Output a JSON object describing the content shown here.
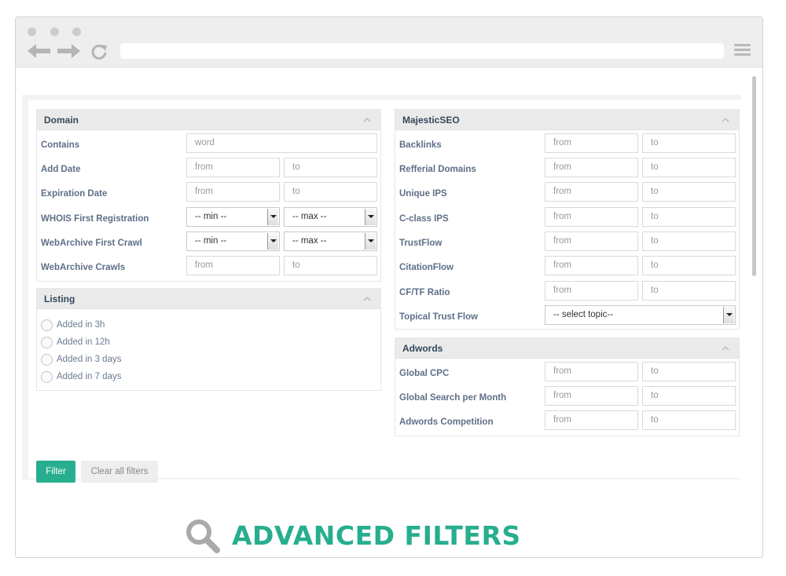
{
  "browser": {
    "colors": {
      "accent": "#27ae8f",
      "header": "#34495e",
      "label": "#5e6f87"
    }
  },
  "domain_panel": {
    "title": "Domain",
    "rows": [
      {
        "label": "Contains",
        "placeholder": "word"
      },
      {
        "label": "Add Date",
        "from": "from",
        "to": "to"
      },
      {
        "label": "Expiration Date",
        "from": "from",
        "to": "to"
      },
      {
        "label": "WHOIS First Registration",
        "min": "-- min --",
        "max": "-- max --"
      },
      {
        "label": "WebArchive First Crawl",
        "min": "-- min --",
        "max": "-- max --"
      },
      {
        "label": "WebArchive Crawls",
        "from": "from",
        "to": "to"
      }
    ]
  },
  "listing_panel": {
    "title": "Listing",
    "options": [
      "Added in 3h",
      "Added in 12h",
      "Added in 3 days",
      "Added in 7 days"
    ]
  },
  "majestic_panel": {
    "title": "MajesticSEO",
    "rows": [
      {
        "label": "Backlinks",
        "from": "from",
        "to": "to"
      },
      {
        "label": "Refferial Domains",
        "from": "from",
        "to": "to"
      },
      {
        "label": "Unique IPS",
        "from": "from",
        "to": "to"
      },
      {
        "label": "C-class IPS",
        "from": "from",
        "to": "to"
      },
      {
        "label": "TrustFlow",
        "from": "from",
        "to": "to"
      },
      {
        "label": "CitationFlow",
        "from": "from",
        "to": "to"
      },
      {
        "label": "CF/TF Ratio",
        "from": "from",
        "to": "to"
      },
      {
        "label": "Topical Trust Flow",
        "select": "-- select topic--"
      }
    ]
  },
  "adwords_panel": {
    "title": "Adwords",
    "rows": [
      {
        "label": "Global CPC",
        "from": "from",
        "to": "to"
      },
      {
        "label": "Global Search per Month",
        "from": "from",
        "to": "to"
      },
      {
        "label": "Adwords Competition",
        "from": "from",
        "to": "to"
      }
    ]
  },
  "actions": {
    "filter_label": "Filter",
    "clear_label": "Clear all filters"
  },
  "banner": {
    "text": "ADVANCED FILTERS",
    "icon": "search-icon"
  }
}
